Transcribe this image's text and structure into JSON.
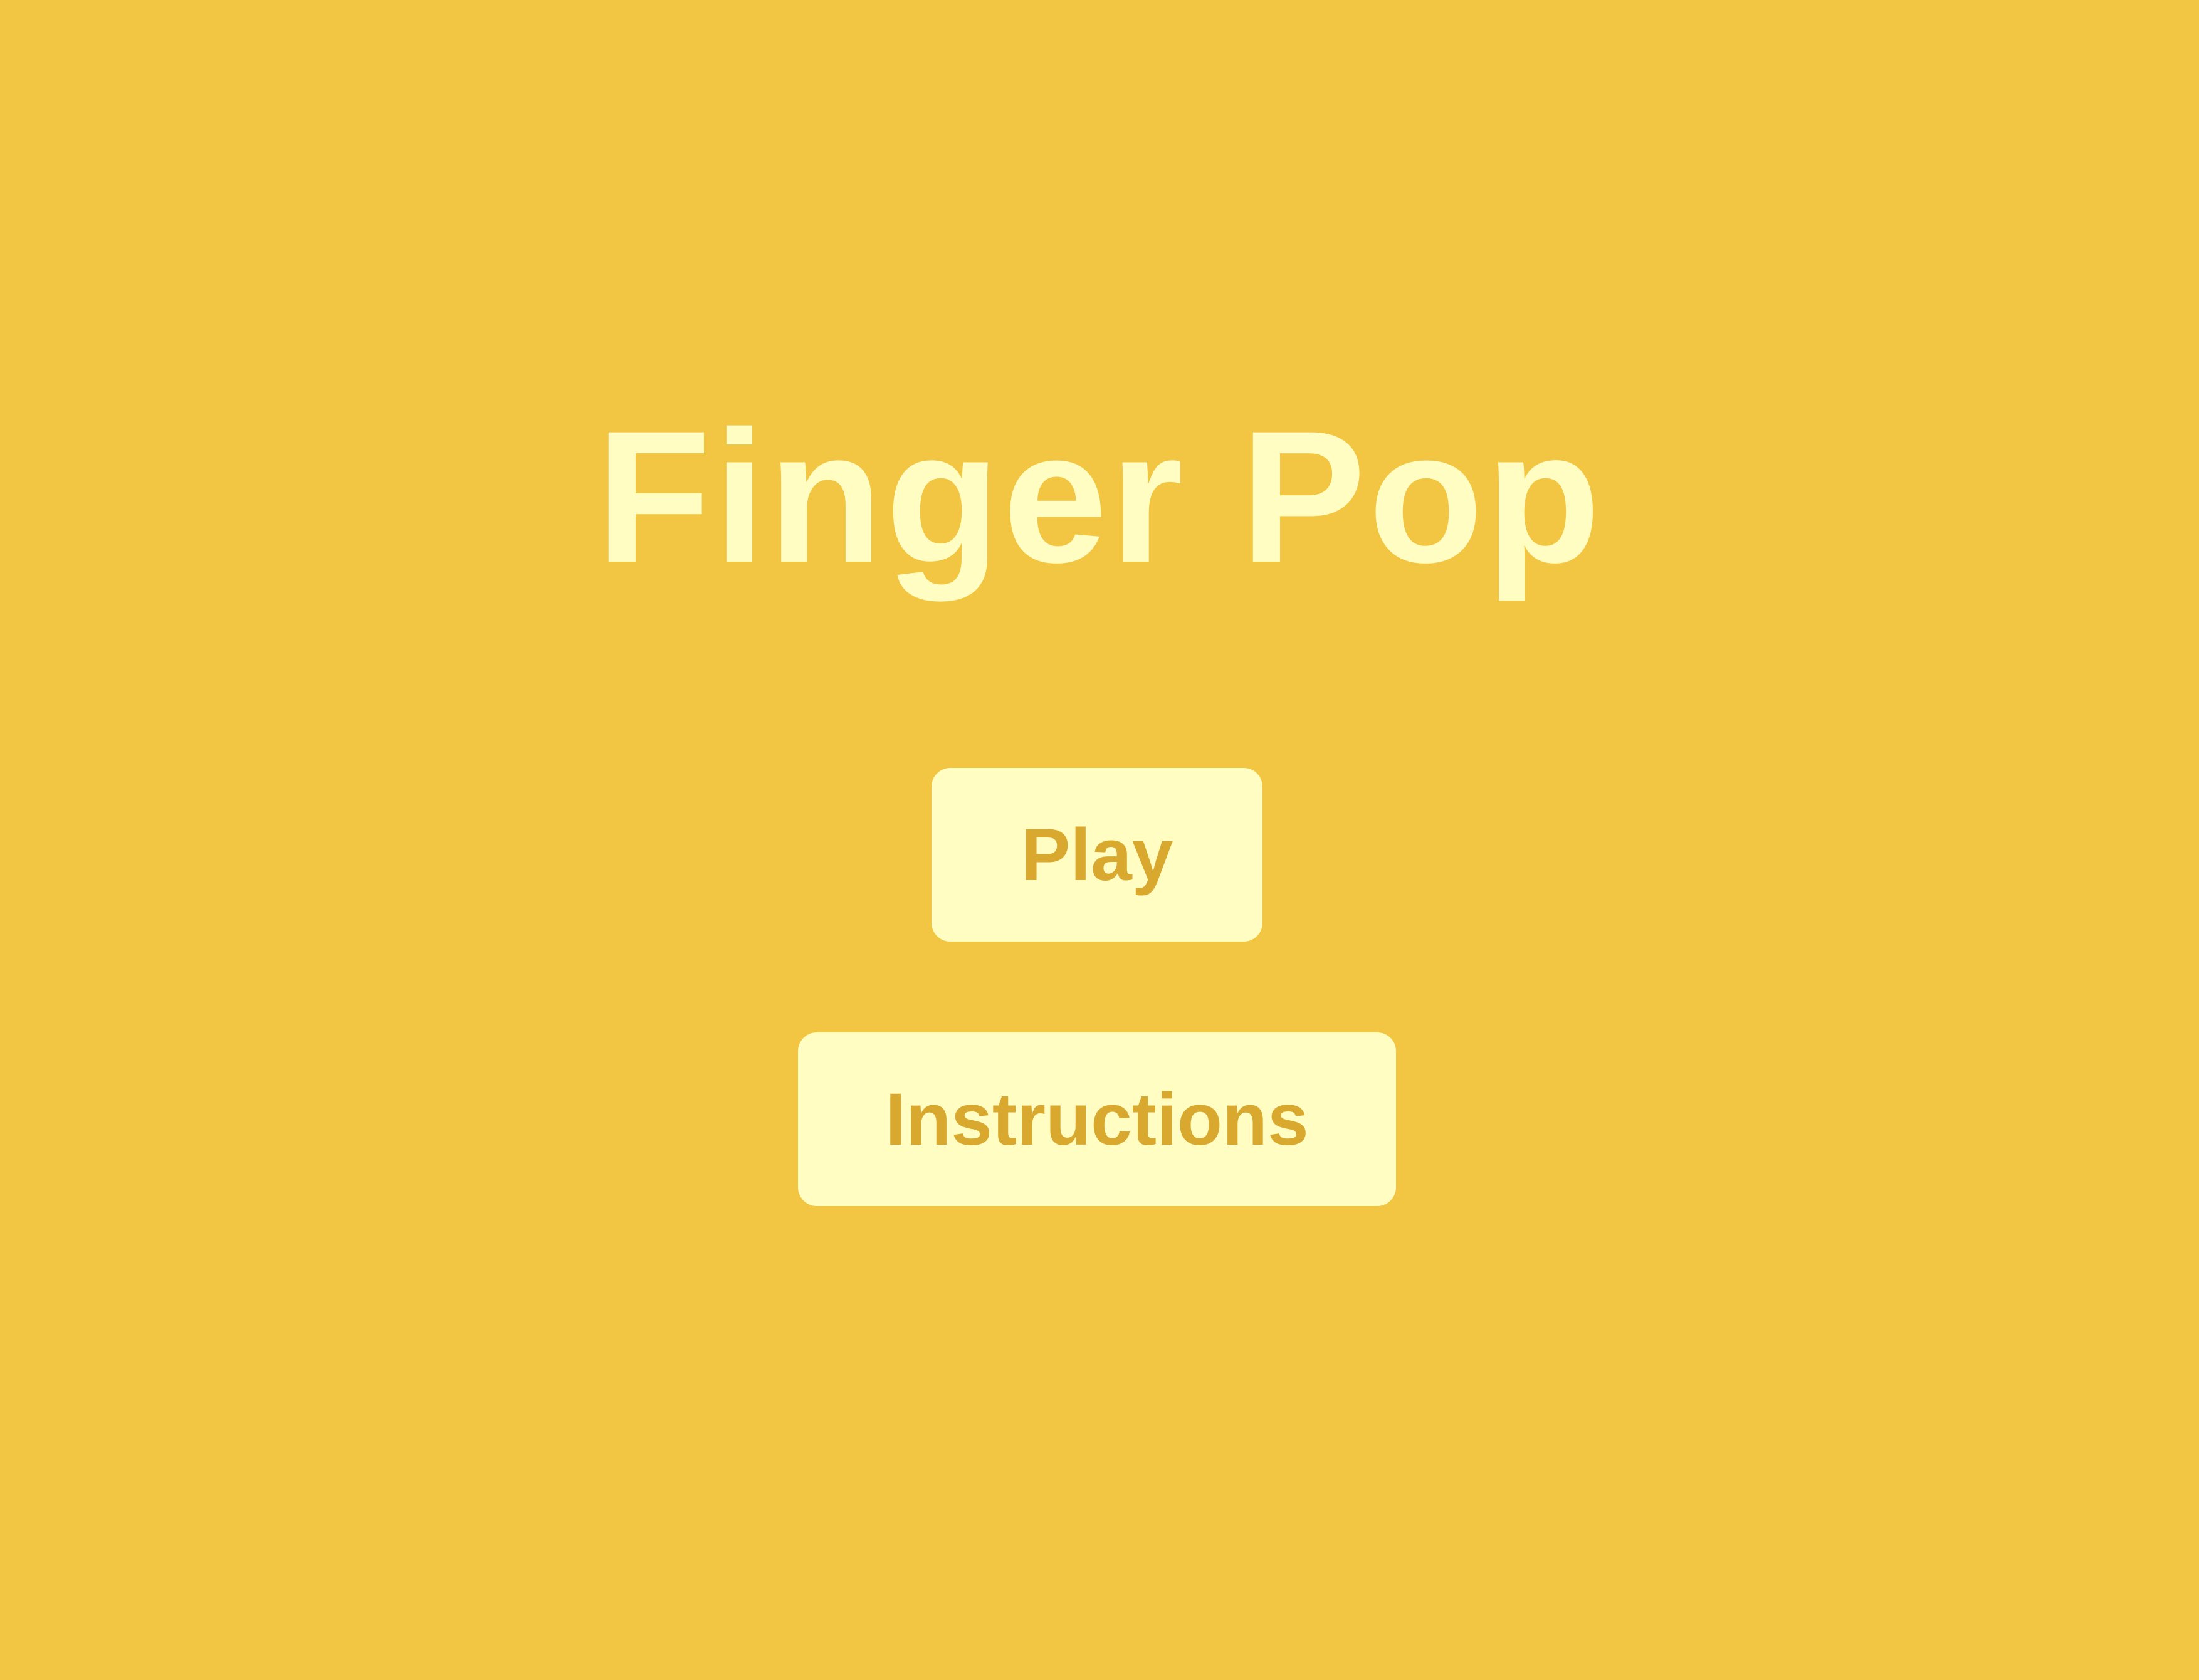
{
  "game": {
    "title": "Finger Pop"
  },
  "menu": {
    "play_label": "Play",
    "instructions_label": "Instructions"
  },
  "colors": {
    "background": "#F2C643",
    "title_text": "#FFFDC2",
    "button_background": "#FFFDC2",
    "button_text": "#D9A82E"
  }
}
